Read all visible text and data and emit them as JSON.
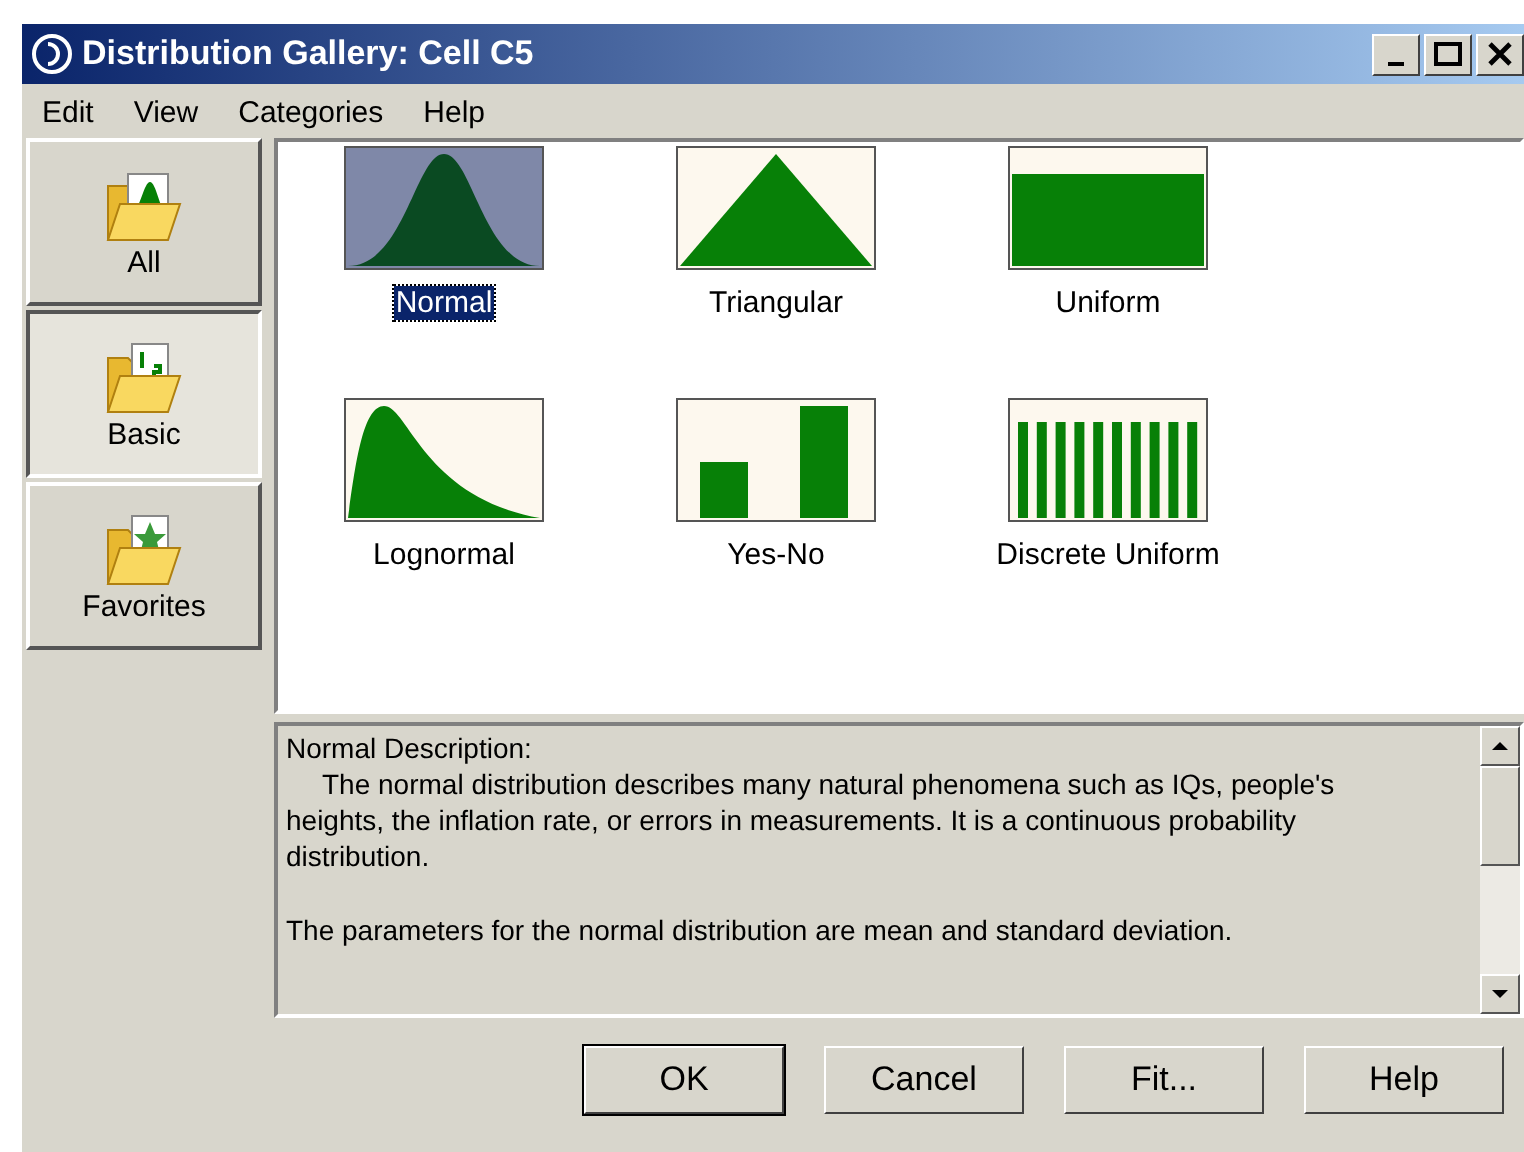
{
  "window": {
    "title": "Distribution Gallery: Cell C5"
  },
  "menu": [
    "Edit",
    "View",
    "Categories",
    "Help"
  ],
  "categories": [
    {
      "label": "All",
      "kind": "chart",
      "selected": false
    },
    {
      "label": "Basic",
      "kind": "numbers",
      "selected": true
    },
    {
      "label": "Favorites",
      "kind": "star",
      "selected": false
    }
  ],
  "distributions": [
    {
      "label": "Normal",
      "kind": "normal",
      "selected": true
    },
    {
      "label": "Triangular",
      "kind": "triangular",
      "selected": false
    },
    {
      "label": "Uniform",
      "kind": "uniform",
      "selected": false
    },
    {
      "label": "Lognormal",
      "kind": "lognormal",
      "selected": false
    },
    {
      "label": "Yes-No",
      "kind": "yesno",
      "selected": false
    },
    {
      "label": "Discrete Uniform",
      "kind": "discrete",
      "selected": false
    }
  ],
  "description": {
    "heading": "Normal Description:",
    "paragraphs": [
      "The normal distribution describes many natural phenomena such as IQs, people's heights, the inflation rate, or errors in measurements. It is a continuous probability distribution.",
      "The parameters for the normal distribution are mean and standard deviation."
    ]
  },
  "buttons": [
    {
      "label": "OK",
      "default": true
    },
    {
      "label": "Cancel",
      "default": false
    },
    {
      "label": "Fit...",
      "default": false
    },
    {
      "label": "Help",
      "default": false
    }
  ]
}
